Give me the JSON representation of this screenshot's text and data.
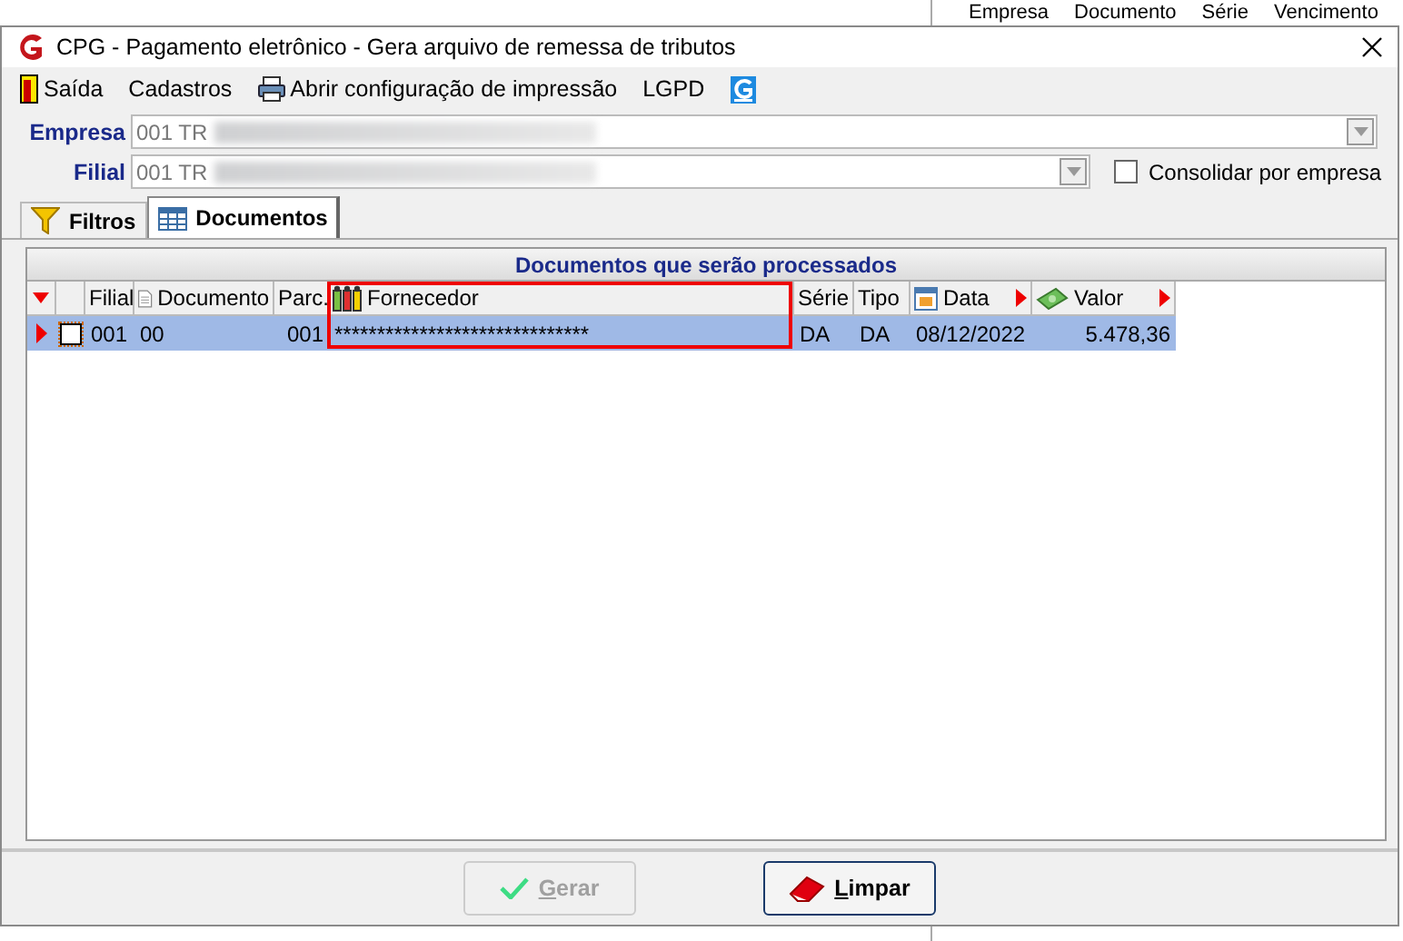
{
  "background_window": {
    "columns": [
      "Empresa",
      "Documento",
      "Série",
      "Vencimento"
    ]
  },
  "window": {
    "title": "CPG -  Pagamento eletrônico - Gera arquivo de remessa de tributos"
  },
  "menu": [
    {
      "kind": "exit",
      "label": "Saída"
    },
    {
      "kind": "plain",
      "label": "Cadastros"
    },
    {
      "kind": "print",
      "label": "Abrir configuração de impressão"
    },
    {
      "kind": "plain",
      "label": "LGPD"
    },
    {
      "kind": "logo"
    }
  ],
  "empresa": {
    "label": "Empresa",
    "value": "001 TR"
  },
  "filial": {
    "label": "Filial",
    "value": "001 TR"
  },
  "consolidar": {
    "label": "Consolidar por empresa",
    "checked": false
  },
  "tabs": [
    {
      "kind": "filter",
      "label": "Filtros",
      "selected": false
    },
    {
      "kind": "table",
      "label": "Documentos",
      "selected": true
    }
  ],
  "grid": {
    "title": "Documentos que serão processados",
    "columns": [
      {
        "kind": "plain",
        "label": "Filial"
      },
      {
        "kind": "document",
        "label": "Documento"
      },
      {
        "kind": "plain",
        "label": "Parc."
      },
      {
        "kind": "supplier",
        "label": "Fornecedor",
        "highlighted": true
      },
      {
        "kind": "plain",
        "label": "Série"
      },
      {
        "kind": "plain",
        "label": "Tipo"
      },
      {
        "kind": "date",
        "label": "Data",
        "arrow": true
      },
      {
        "kind": "money",
        "label": "Valor",
        "arrow": true
      }
    ],
    "rows": [
      {
        "selected": true,
        "checked": false,
        "cells": [
          "001",
          "00",
          "001",
          "******************************",
          "DA",
          "DA",
          "08/12/2022",
          "5.478,36"
        ]
      }
    ]
  },
  "buttons": [
    {
      "kind": "generate",
      "label": "Gerar",
      "disabled": true
    },
    {
      "kind": "clear",
      "label": "Limpar",
      "disabled": false
    }
  ]
}
